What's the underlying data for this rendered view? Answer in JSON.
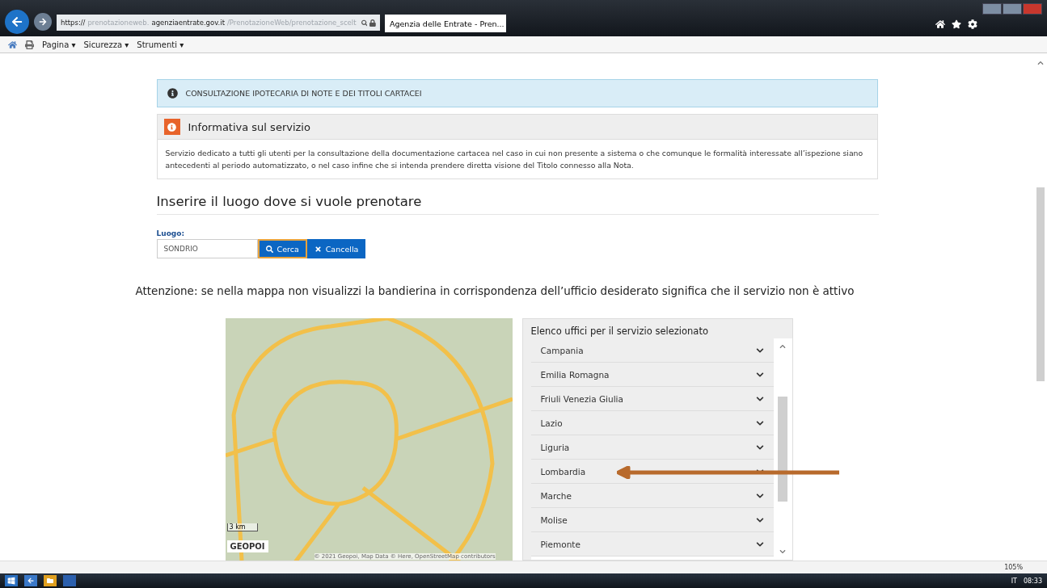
{
  "browser": {
    "url_prefix": "https://",
    "url_faded_1": "prenotazioneweb.",
    "url_domain": "agenziaentrate.gov.it",
    "url_faded_2": "/PrenotazioneWeb/prenotazione_scelt",
    "tab_title": "Agenzia delle Entrate - Pren...",
    "menus": [
      "Pagina ▾",
      "Sicurezza ▾",
      "Strumenti ▾"
    ],
    "zoom": "105%"
  },
  "notice": {
    "text": "CONSULTAZIONE IPOTECARIA DI NOTE E DEI TITOLI CARTACEI"
  },
  "info_panel": {
    "title": "Informativa sul servizio",
    "body": "Servizio dedicato a tutti gli utenti per la consultazione della documentazione cartacea nel caso in cui non presente a sistema o che comunque le formalità interessate all’ispezione siano antecedenti al periodo automatizzato, o nel caso infine che si intenda prendere diretta visione del Titolo connesso alla Nota."
  },
  "section_title": "Inserire il luogo dove si vuole prenotare",
  "search": {
    "label": "Luogo:",
    "value": "SONDRIO",
    "buttons": [
      "Cerca",
      "Cancella"
    ]
  },
  "warning": "Attenzione: se nella mappa non visualizzi la bandierina in corrispondenza dell’ufficio desiderato significa che il servizio non è attivo",
  "map": {
    "scale": "3 km",
    "logo": "GEOPOI",
    "attribution": "© 2021 Geopoi, Map Data © Here, OpenStreetMap contributors"
  },
  "offices": {
    "title": "Elenco uffici per il servizio selezionato",
    "items": [
      {
        "label": "Campania",
        "expanded": false
      },
      {
        "label": "Emilia Romagna",
        "expanded": false
      },
      {
        "label": "Friuli Venezia Giulia",
        "expanded": false
      },
      {
        "label": "Lazio",
        "expanded": false
      },
      {
        "label": "Liguria",
        "expanded": false
      },
      {
        "label": "Lombardia",
        "expanded": false
      },
      {
        "label": "Marche",
        "expanded": false
      },
      {
        "label": "Molise",
        "expanded": false
      },
      {
        "label": "Piemonte",
        "expanded": false
      }
    ]
  },
  "taskbar": {
    "language": "IT",
    "time": "08:33"
  }
}
